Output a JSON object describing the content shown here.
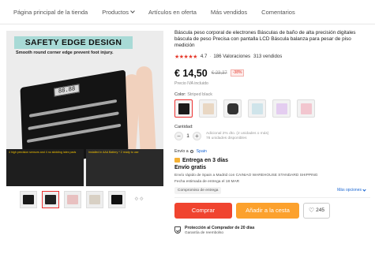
{
  "nav": {
    "items": [
      {
        "label": "Página principal de la tienda"
      },
      {
        "label": "Productos"
      },
      {
        "label": "Artículos en oferta"
      },
      {
        "label": "Más vendidos"
      },
      {
        "label": "Comentarios"
      }
    ]
  },
  "gallery": {
    "banner_title": "SAFETY EDGE DESIGN",
    "banner_sub": "Smooth round corner edge prevent foot injury.",
    "display_text": "88.88",
    "panel_left": "4 high precision sensors and 4 no skidding latex pads",
    "panel_right": "Installed in AAA Battery * 2 ready to use",
    "thumb_more": "⟐ ⟐"
  },
  "product": {
    "title": "Báscula peso corporal de electrones Básculas de baño de alta precisión digitales báscula de peso Precisa con pantalla LCD Báscula balanza para pesar de piso medición",
    "stars": "★★★★★",
    "rating": "4.7",
    "reviews": "186 Valoraciones",
    "sold": "313 vendidos",
    "price": "€ 14,50",
    "old_price": "€ 23,37",
    "discount": "-38%",
    "vat": "Precio IVA incluido",
    "color_label": "Color:",
    "color_value": "Striped black",
    "quantity_label": "Cantidad:",
    "quantity_value": "1",
    "minus": "−",
    "plus": "+",
    "quantity_note1": "Adicional 2% dto. (2 unidades o más)",
    "quantity_note2": "78 unidades disponibles"
  },
  "shipping": {
    "ship_to_label": "Envío a",
    "ship_to_place": "Spain",
    "delivery": "Entrega en 3 días",
    "free": "Envío gratis",
    "info": "Envío rápido de Spain a Madrid con CAINIAO WAREHOUSE STANDARD SHIPPING",
    "estimate": "Fecha estimada de entrega el 18 MAR",
    "commitment": "Compromiso de entrega",
    "more_options": "Más opciones"
  },
  "actions": {
    "buy": "Comprar",
    "cart": "Añadir a la cesta",
    "wishlist_count": "245"
  },
  "protection": {
    "title": "Protección al Comprador de 20 días",
    "subtitle": "Garantía de reembolso"
  },
  "colors": {
    "accent_red": "#f0442f",
    "accent_orange": "#fca12d",
    "star_red": "#e6392b",
    "link_blue": "#1a66d2"
  }
}
